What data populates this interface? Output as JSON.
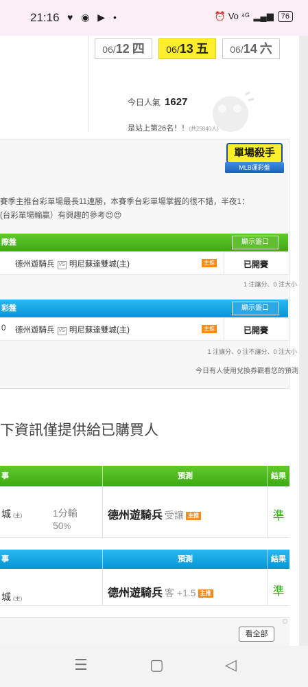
{
  "status_bar": {
    "time": "21:16",
    "icons_left": "♥ ◉ ▶ •",
    "icons_right": "⏰ Vo ⁴ᴳ",
    "battery": "76"
  },
  "dates": [
    {
      "prefix": "06/",
      "day": "12",
      "weekday": "四",
      "active": false
    },
    {
      "prefix": "06/",
      "day": "13",
      "weekday": "五",
      "active": true
    },
    {
      "prefix": "06/",
      "day": "14",
      "weekday": "六",
      "active": false
    }
  ],
  "stats": {
    "popularity_label": "今日人氣",
    "popularity_value": "1627",
    "rank_text": "是站上第26名！！",
    "rank_total": "(共25840人)"
  },
  "badge": {
    "title": "單場殺手",
    "subtitle": "MLB運彩盤"
  },
  "description": {
    "line1": "賽季主推台彩單場最長11連勝，本賽季台彩單場掌握的很不錯，半夜1：",
    "line2": "(台彩單場輸贏）有興趣的參考😍😍"
  },
  "sections": [
    {
      "title": "際盤",
      "show_label": "顯示盤口",
      "home": "德州遊騎兵",
      "vs": "VS",
      "away": "明尼蘇達雙城(主)",
      "lead": "",
      "tag": "主推",
      "status": "已開賽",
      "note": "1 注讓分、0 注大小"
    },
    {
      "title": "彩盤",
      "show_label": "顯示盤口",
      "home": "德州遊騎兵",
      "vs": "VS",
      "away": "明尼蘇達雙城(主)",
      "lead": "0",
      "tag": "主推",
      "status": "已開賽",
      "note": "1 注讓分、0 注不讓分、0 注大小",
      "note2": "今日有人使用兌換券觀看您的預測"
    }
  ],
  "headline": "下資訊僅提供給已購買人",
  "result_tables": [
    {
      "col1": "事",
      "col2": "預測",
      "col3": "結果",
      "home": "城",
      "home_tag": "(主)",
      "score_line1": "1分輸",
      "score_line2": "50",
      "score_unit": "%",
      "pick_team": "德州遊騎兵",
      "pick_sub": "受讓",
      "pick_tag": "主推",
      "result": "準"
    },
    {
      "col1": "事",
      "col2": "預測",
      "col3": "結果",
      "home": "城",
      "home_tag": "(主)",
      "pick_team": "德州遊騎兵",
      "pick_sub": "客 +1.5",
      "pick_tag": "主推",
      "result": "準"
    }
  ],
  "more_label": "看全部",
  "nav": {
    "menu_icon": "☰",
    "home_icon": "▢",
    "back_icon": "◁"
  }
}
